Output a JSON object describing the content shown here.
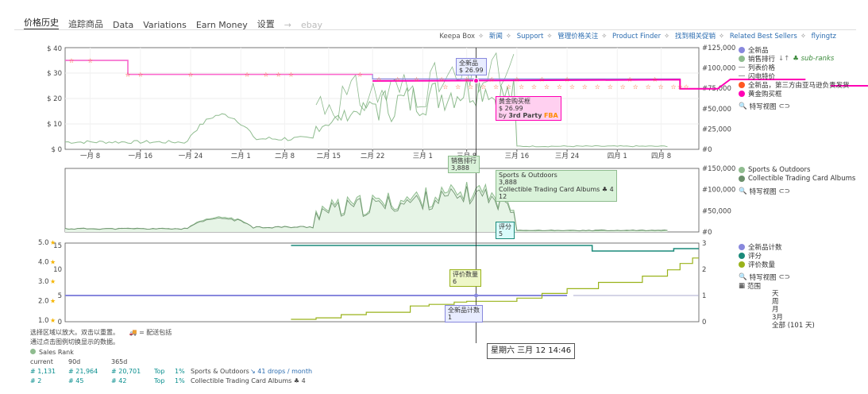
{
  "tabs": [
    "价格历史",
    "追踪商品",
    "Data",
    "Variations",
    "Earn Money",
    "设置",
    "→",
    "ebay"
  ],
  "toplinks": [
    "Keepa Box",
    "新闻",
    "Support",
    "管理价格关注",
    "Product Finder",
    "找到相关促销",
    "Related Best Sellers",
    "flyingtz"
  ],
  "legend_main": {
    "new": "全新品",
    "sales_rank": "销售排行",
    "sub_ranks": "sub-ranks",
    "list": "列表价格",
    "lightning": "闪电特价",
    "third_party": "全新品，第三方由亚马逊负责发货",
    "buybox": "黄金购买框",
    "zoom": "特写视图"
  },
  "legend_rank": {
    "cat1": "Sports & Outdoors",
    "cat2": "Collectible Trading Card Albums",
    "zoom": "特写视图"
  },
  "legend_bottom": {
    "new_count": "全新品计数",
    "rating": "评分",
    "review_count": "评价数量",
    "zoom": "特写视图",
    "range_label": "范围"
  },
  "range": [
    "天",
    "周",
    "月",
    "3月",
    "全部 (101 天)"
  ],
  "colors": {
    "new": "#8888dd",
    "sales_rank": "#8fbc8f",
    "buybox": "#ff00b4",
    "third_party": "#ff5722",
    "rating": "#1a8a7a",
    "reviews": "#99b21a"
  },
  "chart_data": [
    {
      "type": "line",
      "title": "",
      "x_ticks": [
        "一月 8",
        "一月 16",
        "一月 24",
        "二月 1",
        "二月 8",
        "二月 15",
        "二月 22",
        "三月 1",
        "三月 8",
        "三月 16",
        "三月 24",
        "四月 1",
        "四月 8"
      ],
      "y_ticks_left": [
        "$ 0",
        "$ 10",
        "$ 20",
        "$ 30",
        "$ 40"
      ],
      "y_ticks_right": [
        "#0",
        "#25,000",
        "#50,000",
        "#75,000",
        "#100,000",
        "#125,000"
      ],
      "ylim_left": [
        0,
        40
      ],
      "ylim_right": [
        0,
        125000
      ],
      "series": [
        {
          "name": "全新品",
          "points": [
            [
              0,
              35
            ],
            [
              10,
              35
            ],
            [
              10,
              29.5
            ],
            [
              49,
              29.5
            ],
            [
              49,
              27.7
            ],
            [
              98,
              27.7
            ],
            [
              98,
              26.99
            ]
          ]
        },
        {
          "name": "黄金购买框",
          "points": [
            [
              49,
              26.9
            ],
            [
              98,
              27.4
            ],
            [
              98,
              23.8
            ],
            [
              104,
              23.8
            ],
            [
              106,
              27.5
            ],
            [
              118,
              27.5
            ]
          ]
        },
        {
          "name": "全新品，第三方由亚马逊负责发货",
          "points": [
            [
              122,
              25
            ],
            [
              148,
              25
            ],
            [
              156,
              24.7
            ],
            [
              178,
              24.7
            ]
          ]
        }
      ],
      "tooltip_new": {
        "label": "全新品",
        "value": "$ 26.99"
      },
      "tooltip_buybox": {
        "label": "黄金购买框",
        "value": "$ 26.99",
        "by": "by",
        "seller": "3rd Party",
        "fba": "FBA"
      },
      "tooltip_rank": {
        "label": "销售排行",
        "value": "3,888"
      }
    },
    {
      "type": "line",
      "title": "",
      "y_ticks_right": [
        "#0",
        "#50,000",
        "#100,000",
        "#150,000"
      ],
      "ylim_right": [
        0,
        150000
      ],
      "tooltip": {
        "cat1": "Sports & Outdoors",
        "v1": "3,888",
        "cat2": "Collectible Trading Card Albums",
        "v2": "4",
        "v3": "12"
      }
    },
    {
      "type": "line",
      "title": "",
      "y_ticks_stars": [
        "1.0",
        "2.0",
        "3.0",
        "4.0",
        "5.0"
      ],
      "y_ticks_left": [
        "0",
        "5",
        "10",
        "15"
      ],
      "y_ticks_right": [
        "0",
        "1",
        "2",
        "3"
      ],
      "series": [
        {
          "name": "全新品计数",
          "value": 1
        },
        {
          "name": "评分",
          "value": 5
        },
        {
          "name": "评价数量",
          "value": 6
        }
      ],
      "tooltip_reviews": {
        "label": "评价数量",
        "value": "6"
      },
      "tooltip_count": {
        "label": "全新品计数",
        "value": "1"
      },
      "tooltip_rating": {
        "label": "评分",
        "value": "5"
      },
      "crosshair_label": "星期六 三月 12 14:46"
    }
  ],
  "bottom": {
    "hint1": "选择区域以放大。双击以重置。",
    "hint2": "= 配送包括",
    "hint3": "通过点击图例切换显示的数据。",
    "sales_rank_title": "Sales Rank",
    "cols": [
      "current",
      "90d",
      "365d"
    ],
    "row1": [
      "# 1,131",
      "# 21,964",
      "# 20,701",
      "Top",
      "1%",
      "Sports & Outdoors",
      "41 drops / month"
    ],
    "row2": [
      "# 2",
      "# 45",
      "# 42",
      "Top",
      "1%",
      "Collectible Trading Card Albums"
    ]
  }
}
